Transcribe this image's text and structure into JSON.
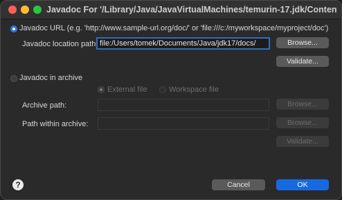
{
  "window": {
    "title": "Javadoc For '/Library/Java/JavaVirtualMachines/temurin-17.jdk/Contents/Ho..."
  },
  "url_option": {
    "label": "Javadoc URL (e.g. 'http://www.sample-url.org/doc/' or 'file:///c:/myworkspace/myproject/doc')",
    "location_label": "Javadoc location path:",
    "location_value": "file:/Users/tomek/Documents/Java/jdk17/docs/",
    "browse": "Browse...",
    "validate": "Validate..."
  },
  "archive_option": {
    "label": "Javadoc in archive",
    "external_label": "External file",
    "workspace_label": "Workspace file",
    "archive_path_label": "Archive path:",
    "archive_path_value": "",
    "path_within_label": "Path within archive:",
    "path_within_value": "",
    "browse1": "Browse...",
    "browse2": "Browse...",
    "validate": "Validate..."
  },
  "footer": {
    "help": "?",
    "cancel": "Cancel",
    "ok": "OK"
  },
  "colors": {
    "accent": "#1769e0",
    "background": "#2a2a2a"
  }
}
